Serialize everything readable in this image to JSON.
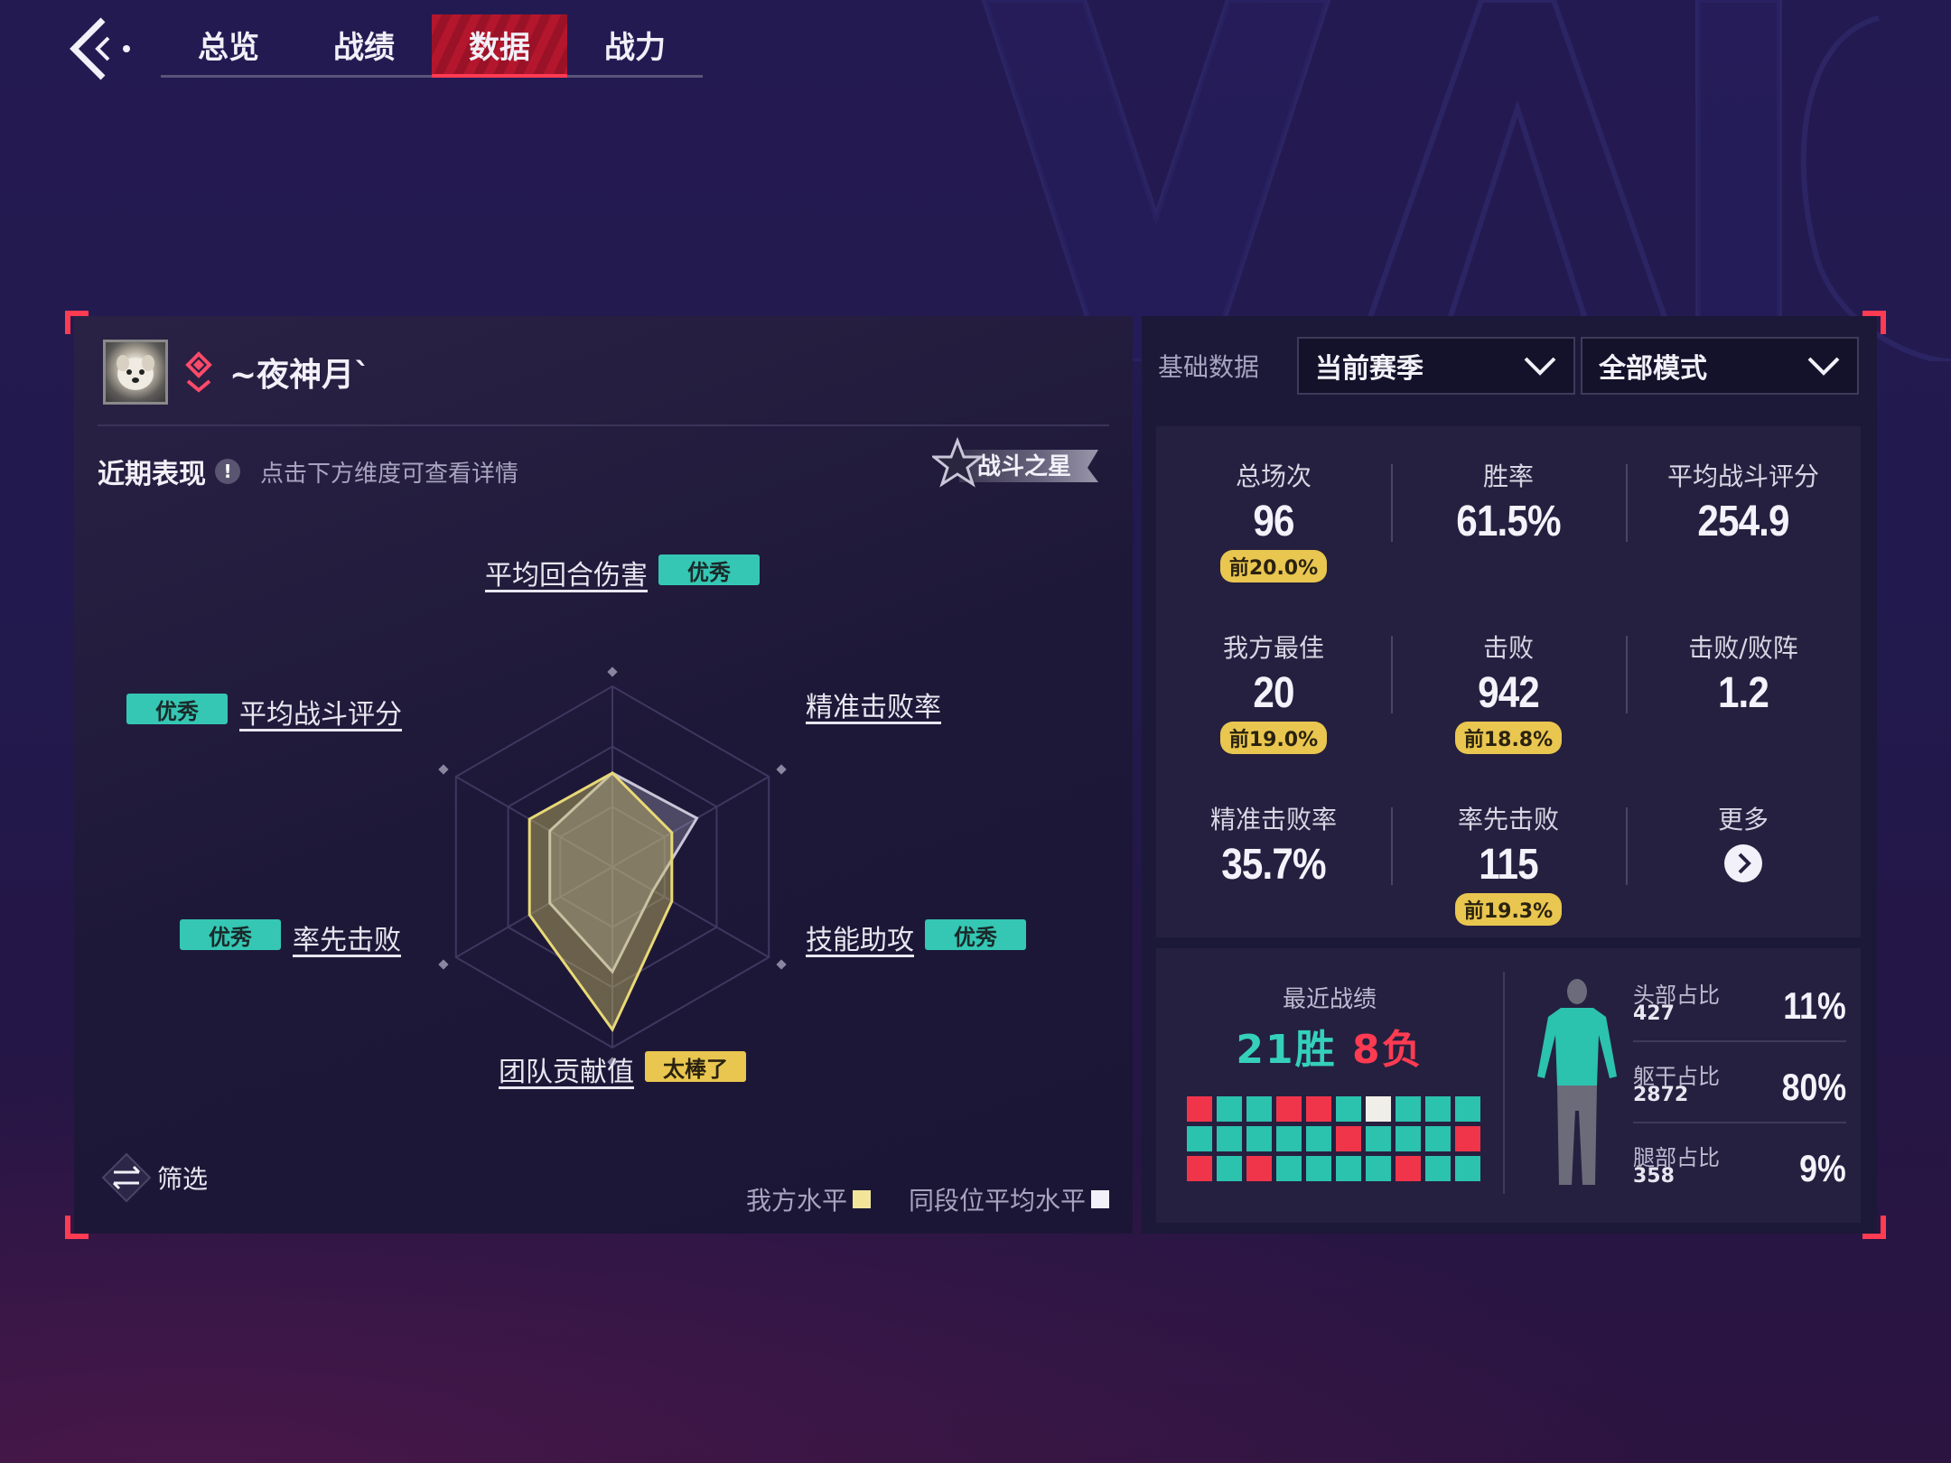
{
  "nav": {
    "tabs": [
      {
        "label": "总览",
        "active": false
      },
      {
        "label": "战绩",
        "active": false
      },
      {
        "label": "数据",
        "active": true
      },
      {
        "label": "战力",
        "active": false
      }
    ]
  },
  "player": {
    "name": "~夜神月`",
    "rank_icon": "diamond-rank-icon"
  },
  "recent": {
    "title": "近期表现",
    "hint": "点击下方维度可查看详情",
    "badge": "战斗之星"
  },
  "radar": {
    "dimensions": [
      {
        "label": "平均回合伤害",
        "tag": "优秀",
        "tag_color": "teal",
        "mine": 0.52,
        "avg": 0.52
      },
      {
        "label": "精准击败率",
        "tag": "",
        "tag_color": "",
        "mine": 0.38,
        "avg": 0.54
      },
      {
        "label": "技能助攻",
        "tag": "优秀",
        "tag_color": "teal",
        "mine": 0.38,
        "avg": 0.26
      },
      {
        "label": "团队贡献值",
        "tag": "太棒了",
        "tag_color": "gold",
        "mine": 0.9,
        "avg": 0.58
      },
      {
        "label": "率先击败",
        "tag": "优秀",
        "tag_color": "teal",
        "mine": 0.53,
        "avg": 0.4
      },
      {
        "label": "平均战斗评分",
        "tag": "优秀",
        "tag_color": "teal",
        "mine": 0.53,
        "avg": 0.4
      }
    ],
    "colors": {
      "mine": "#e8d976",
      "avg": "#c9c6d8"
    }
  },
  "filter": {
    "label": "筛选"
  },
  "legend": {
    "mine": "我方水平",
    "avg": "同段位平均水平"
  },
  "basic": {
    "title": "基础数据",
    "season": "当前赛季",
    "mode": "全部模式"
  },
  "stats": [
    {
      "label": "总场次",
      "value": "96",
      "badge": "前20.0%"
    },
    {
      "label": "胜率",
      "value": "61.5%",
      "badge": ""
    },
    {
      "label": "平均战斗评分",
      "value": "254.9",
      "badge": ""
    },
    {
      "label": "我方最佳",
      "value": "20",
      "badge": "前19.0%"
    },
    {
      "label": "击败",
      "value": "942",
      "badge": "前18.8%"
    },
    {
      "label": "击败/败阵",
      "value": "1.2",
      "badge": ""
    },
    {
      "label": "精准击败率",
      "value": "35.7%",
      "badge": ""
    },
    {
      "label": "率先击败",
      "value": "115",
      "badge": "前19.3%"
    },
    {
      "label": "更多",
      "value": "",
      "badge": ""
    }
  ],
  "recent_matches": {
    "title": "最近战绩",
    "wins": "21胜",
    "losses": "8负",
    "results": [
      "L",
      "W",
      "W",
      "L",
      "L",
      "W",
      "D",
      "W",
      "W",
      "W",
      "W",
      "W",
      "W",
      "W",
      "W",
      "L",
      "W",
      "W",
      "W",
      "L",
      "L",
      "W",
      "L",
      "W",
      "W",
      "W",
      "W",
      "L",
      "W",
      "W"
    ]
  },
  "hit_distribution": [
    {
      "label": "头部占比",
      "count": "427",
      "percent": "11%"
    },
    {
      "label": "躯干占比",
      "count": "2872",
      "percent": "80%"
    },
    {
      "label": "腿部占比",
      "count": "358",
      "percent": "9%"
    }
  ]
}
